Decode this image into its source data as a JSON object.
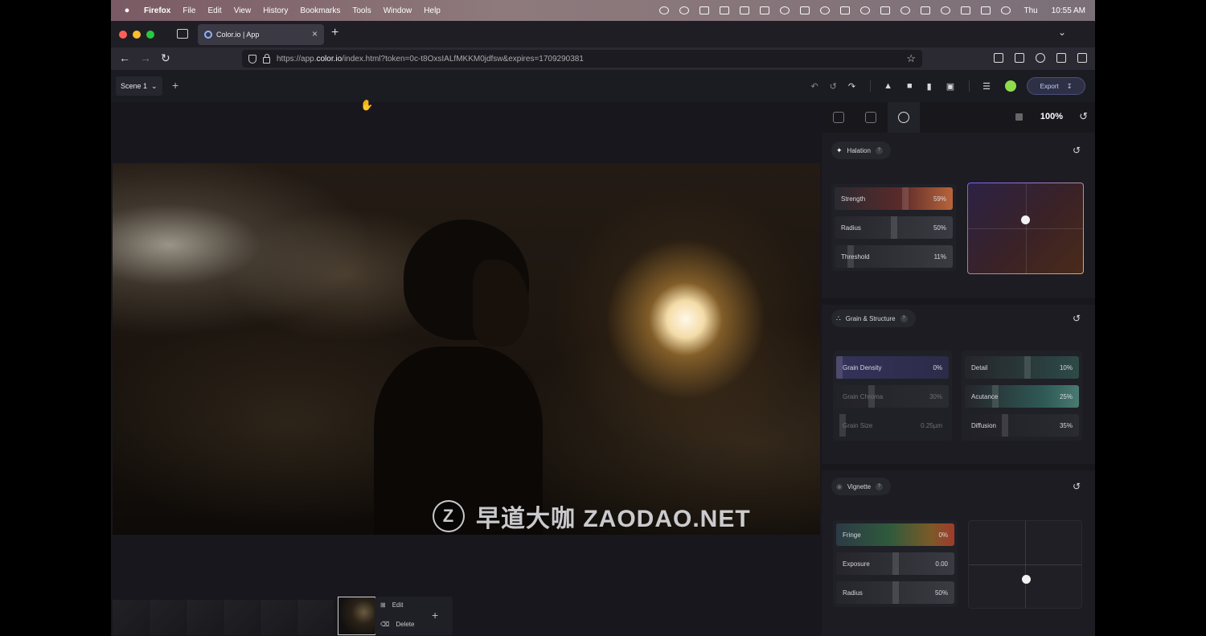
{
  "menubar": {
    "apple": "",
    "app_name": "Firefox",
    "items": [
      "File",
      "Edit",
      "View",
      "History",
      "Bookmarks",
      "Tools",
      "Window",
      "Help"
    ],
    "clock_day": "Thu",
    "clock_time": "10:55 AM"
  },
  "browser": {
    "tab_title": "Color.io | App",
    "tab_close": "×",
    "new_tab": "+",
    "url_prefix": "https://app.",
    "url_host": "color.io",
    "url_rest": "/index.html?token=0c-t8OxsIALfMKKM0jdfsw&expires=1709290381"
  },
  "appbar": {
    "scene_label": "Scene 1",
    "add": "+",
    "export_label": "Export",
    "accent_color": "#8fdc4a"
  },
  "panel": {
    "zoom": "100%",
    "halation": {
      "title": "Halation",
      "help": "?",
      "sliders": [
        {
          "label": "Strength",
          "value": "59%"
        },
        {
          "label": "Radius",
          "value": "50%"
        },
        {
          "label": "Threshold",
          "value": "11%"
        }
      ]
    },
    "grain": {
      "title": "Grain & Structure",
      "help": "?",
      "left": [
        {
          "label": "Grain Density",
          "value": "0%"
        },
        {
          "label": "Grain Chroma",
          "value": "30%"
        },
        {
          "label": "Grain Size",
          "value": "0.25µm"
        }
      ],
      "right": [
        {
          "label": "Detail",
          "value": "10%"
        },
        {
          "label": "Acutance",
          "value": "25%"
        },
        {
          "label": "Diffusion",
          "value": "35%"
        }
      ]
    },
    "vignette": {
      "title": "Vignette",
      "help": "?",
      "sliders": [
        {
          "label": "Fringe",
          "value": "0%"
        },
        {
          "label": "Exposure",
          "value": "0.00"
        },
        {
          "label": "Radius",
          "value": "50%"
        }
      ]
    }
  },
  "filmstrip": {
    "edit_label": "Edit",
    "delete_label": "Delete",
    "add": "+"
  },
  "watermark": {
    "logo": "Z",
    "text": "早道大咖  ZAODAO.NET"
  }
}
